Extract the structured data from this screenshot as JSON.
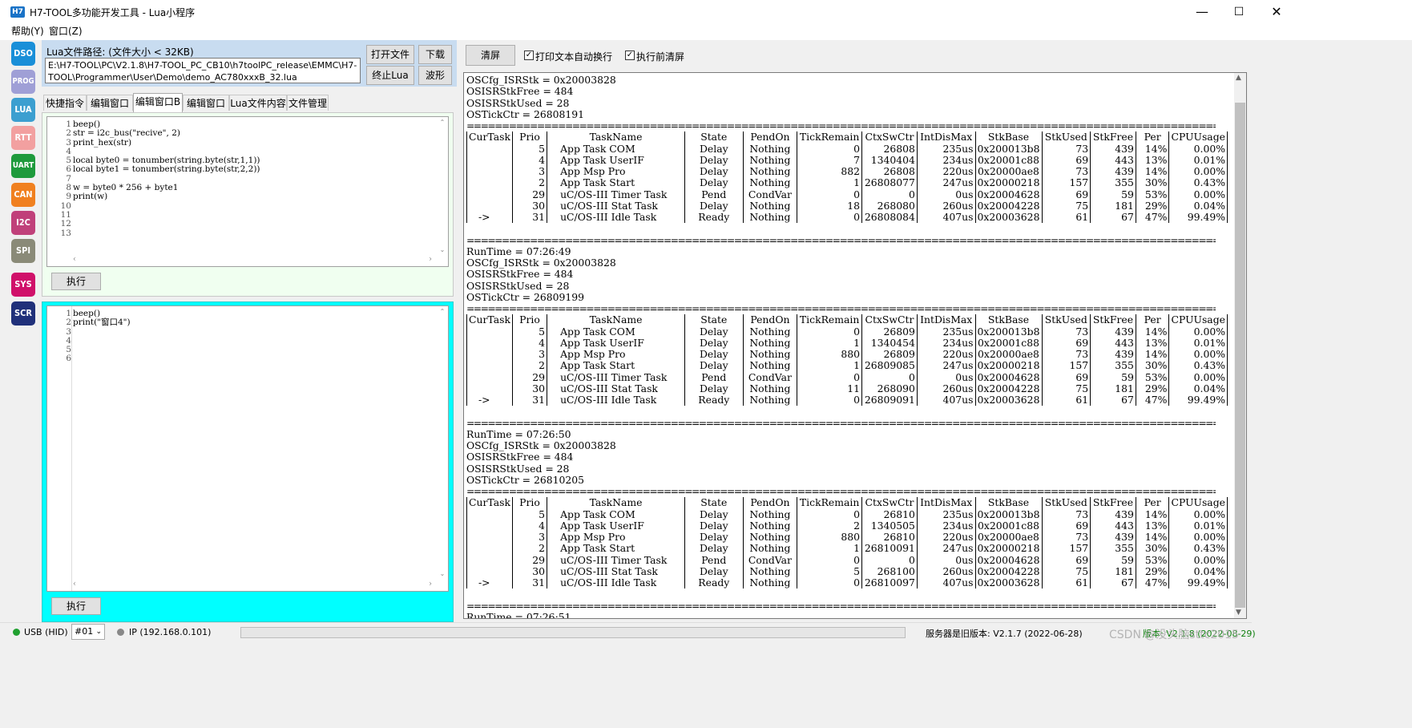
{
  "window": {
    "app_icon": "H7",
    "title": "H7-TOOL多功能开发工具 - Lua小程序",
    "minimize": "—",
    "maximize": "☐",
    "close": "✕"
  },
  "menu": [
    "帮助(Y)",
    "窗口(Z)"
  ],
  "sidebar": [
    {
      "label": "DSO",
      "color": "#1a8fd8"
    },
    {
      "label": "PROG",
      "color": "#9f9fd6"
    },
    {
      "label": "LUA",
      "color": "#3c9fd0"
    },
    {
      "label": "RTT",
      "color": "#f2a0a0"
    },
    {
      "label": "UART",
      "color": "#1e9a3c"
    },
    {
      "label": "CAN",
      "color": "#f08020"
    },
    {
      "label": "I2C",
      "color": "#c0407a"
    },
    {
      "label": "SPI",
      "color": "#8a8a78"
    },
    {
      "label": "SYS",
      "color": "#d0106a"
    },
    {
      "label": "SCR",
      "color": "#20307a"
    }
  ],
  "lua_path": {
    "label": "Lua文件路径: (文件大小 < 32KB)",
    "value_line1": "E:\\H7-TOOL\\PC\\V2.1.8\\H7-TOOL_PC_CB10\\h7toolPC_release\\EMMC\\H7-",
    "value_line2": "TOOL\\Programmer\\User\\Demo\\demo_AC780xxxB_32.lua",
    "open_file": "打开文件",
    "download": "下载",
    "stop_lua": "终止Lua",
    "waveform": "波形"
  },
  "tabs": [
    "快捷指令",
    "编辑窗口A",
    "编辑窗口B",
    "编辑窗口C",
    "Lua文件内容",
    "文件管理"
  ],
  "active_tab": 2,
  "editor_a": {
    "lines": [
      "beep()",
      "str = i2c_bus(\"recive\", 2)",
      "print_hex(str)",
      "",
      "local byte0 = tonumber(string.byte(str,1,1))",
      "local byte1 = tonumber(string.byte(str,2,2))",
      "",
      "w = byte0 * 256 + byte1",
      "print(w)",
      "",
      "",
      "",
      ""
    ],
    "numbers": [
      "1",
      "2",
      "3",
      "4",
      "5",
      "6",
      "7",
      "8",
      "9",
      "10",
      "11",
      "12",
      "13"
    ],
    "exec": "执行"
  },
  "editor_b": {
    "lines": [
      "beep()",
      "print(\"窗口4\")",
      "",
      "",
      "",
      ""
    ],
    "numbers": [
      "1",
      "2",
      "3",
      "4",
      "5",
      "6"
    ],
    "exec": "执行"
  },
  "output_toolbar": {
    "clear": "清屏",
    "wrap_label": "打印文本自动换行",
    "clear_before_label": "执行前清屏",
    "checkmark": "✓"
  },
  "output": {
    "top_lines": [
      "OSCfg_ISRStk = 0x20003828",
      "OSISRStkFree = 484",
      "OSISRStkUsed = 28",
      "OSTickCtr = 26808191"
    ],
    "separator": "==================================================================================================================================================",
    "headers": [
      "CurTask",
      "Prio",
      "TaskName",
      "State",
      "PendOn",
      "TickRemain",
      "CtxSwCtr",
      "IntDisMax",
      "StkBase",
      "StkUsed",
      "StkFree",
      "Per",
      "CPUUsage"
    ],
    "blocks": [
      {
        "rows": [
          [
            "",
            "5",
            "App Task COM",
            "Delay",
            "Nothing",
            "0",
            "26808",
            "235us",
            "0x200013b8",
            "73",
            "439",
            "14%",
            "0.00%"
          ],
          [
            "",
            "4",
            "App Task UserIF",
            "Delay",
            "Nothing",
            "7",
            "1340404",
            "234us",
            "0x20001c88",
            "69",
            "443",
            "13%",
            "0.01%"
          ],
          [
            "",
            "3",
            "App Msp Pro",
            "Delay",
            "Nothing",
            "882",
            "26808",
            "220us",
            "0x20000ae8",
            "73",
            "439",
            "14%",
            "0.00%"
          ],
          [
            "",
            "2",
            "App Task Start",
            "Delay",
            "Nothing",
            "1",
            "26808077",
            "247us",
            "0x20000218",
            "157",
            "355",
            "30%",
            "0.43%"
          ],
          [
            "",
            "29",
            "uC/OS-III Timer Task",
            "Pend",
            "CondVar",
            "0",
            "0",
            "0us",
            "0x20004628",
            "69",
            "59",
            "53%",
            "0.00%"
          ],
          [
            "",
            "30",
            "uC/OS-III Stat Task",
            "Delay",
            "Nothing",
            "18",
            "268080",
            "260us",
            "0x20004228",
            "75",
            "181",
            "29%",
            "0.04%"
          ],
          [
            "->",
            "31",
            "uC/OS-III Idle Task",
            "Ready",
            "Nothing",
            "0",
            "26808084",
            "407us",
            "0x20003628",
            "61",
            "67",
            "47%",
            "99.49%"
          ]
        ]
      },
      {
        "info": [
          "RunTime = 07:26:49",
          "OSCfg_ISRStk = 0x20003828",
          "OSISRStkFree = 484",
          "OSISRStkUsed = 28",
          "OSTickCtr = 26809199"
        ],
        "rows": [
          [
            "",
            "5",
            "App Task COM",
            "Delay",
            "Nothing",
            "0",
            "26809",
            "235us",
            "0x200013b8",
            "73",
            "439",
            "14%",
            "0.00%"
          ],
          [
            "",
            "4",
            "App Task UserIF",
            "Delay",
            "Nothing",
            "1",
            "1340454",
            "234us",
            "0x20001c88",
            "69",
            "443",
            "13%",
            "0.01%"
          ],
          [
            "",
            "3",
            "App Msp Pro",
            "Delay",
            "Nothing",
            "880",
            "26809",
            "220us",
            "0x20000ae8",
            "73",
            "439",
            "14%",
            "0.00%"
          ],
          [
            "",
            "2",
            "App Task Start",
            "Delay",
            "Nothing",
            "1",
            "26809085",
            "247us",
            "0x20000218",
            "157",
            "355",
            "30%",
            "0.43%"
          ],
          [
            "",
            "29",
            "uC/OS-III Timer Task",
            "Pend",
            "CondVar",
            "0",
            "0",
            "0us",
            "0x20004628",
            "69",
            "59",
            "53%",
            "0.00%"
          ],
          [
            "",
            "30",
            "uC/OS-III Stat Task",
            "Delay",
            "Nothing",
            "11",
            "268090",
            "260us",
            "0x20004228",
            "75",
            "181",
            "29%",
            "0.04%"
          ],
          [
            "->",
            "31",
            "uC/OS-III Idle Task",
            "Ready",
            "Nothing",
            "0",
            "26809091",
            "407us",
            "0x20003628",
            "61",
            "67",
            "47%",
            "99.49%"
          ]
        ]
      },
      {
        "info": [
          "RunTime = 07:26:50",
          "OSCfg_ISRStk = 0x20003828",
          "OSISRStkFree = 484",
          "OSISRStkUsed = 28",
          "OSTickCtr = 26810205"
        ],
        "rows": [
          [
            "",
            "5",
            "App Task COM",
            "Delay",
            "Nothing",
            "0",
            "26810",
            "235us",
            "0x200013b8",
            "73",
            "439",
            "14%",
            "0.00%"
          ],
          [
            "",
            "4",
            "App Task UserIF",
            "Delay",
            "Nothing",
            "2",
            "1340505",
            "234us",
            "0x20001c88",
            "69",
            "443",
            "13%",
            "0.01%"
          ],
          [
            "",
            "3",
            "App Msp Pro",
            "Delay",
            "Nothing",
            "880",
            "26810",
            "220us",
            "0x20000ae8",
            "73",
            "439",
            "14%",
            "0.00%"
          ],
          [
            "",
            "2",
            "App Task Start",
            "Delay",
            "Nothing",
            "1",
            "26810091",
            "247us",
            "0x20000218",
            "157",
            "355",
            "30%",
            "0.43%"
          ],
          [
            "",
            "29",
            "uC/OS-III Timer Task",
            "Pend",
            "CondVar",
            "0",
            "0",
            "0us",
            "0x20004628",
            "69",
            "59",
            "53%",
            "0.00%"
          ],
          [
            "",
            "30",
            "uC/OS-III Stat Task",
            "Delay",
            "Nothing",
            "5",
            "268100",
            "260us",
            "0x20004228",
            "75",
            "181",
            "29%",
            "0.04%"
          ],
          [
            "->",
            "31",
            "uC/OS-III Idle Task",
            "Ready",
            "Nothing",
            "0",
            "26810097",
            "407us",
            "0x20003628",
            "61",
            "67",
            "47%",
            "99.49%"
          ]
        ]
      }
    ],
    "last_line": "RunTime = 07:26:51"
  },
  "statusbar": {
    "usb": "USB (HID)",
    "device": "#01",
    "ip": "IP (192.168.0.101)",
    "server_version": "服务器是旧版本: V2.1.7 (2022-06-28)",
    "local_version": "版本: V2.1.8 (2022-08-29)",
    "watermark": "CSDN @没头脑sttc2015"
  }
}
